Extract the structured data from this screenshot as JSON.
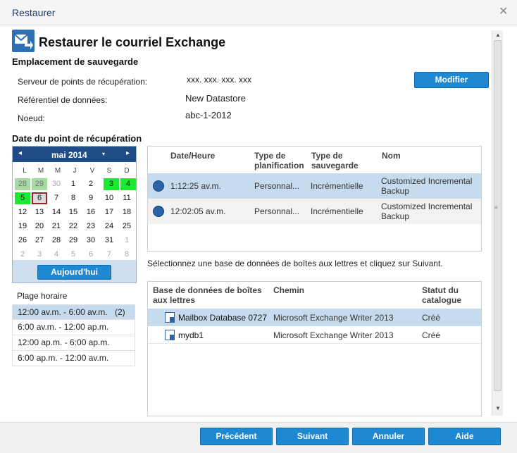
{
  "window": {
    "title": "Restaurer"
  },
  "header": {
    "title": "Restaurer le courriel Exchange"
  },
  "backup_location": {
    "heading": "Emplacement de sauvegarde",
    "server_label": "Serveur de points de récupération:",
    "server_value": "xxx. xxx. xxx. xxx",
    "datastore_label": "Référentiel de données:",
    "datastore_value": "New Datastore",
    "node_label": "Noeud:",
    "node_value": "abc-1-2012",
    "modify_button": "Modifier"
  },
  "recovery_point": {
    "heading": "Date du point de récupération",
    "calendar": {
      "month_label": "mai 2014",
      "prev_arrow": "◂",
      "next_arrow": "▸",
      "dropdown_arrow": "▾",
      "weekdays": [
        "L",
        "M",
        "M",
        "J",
        "V",
        "S",
        "D"
      ],
      "weeks": [
        [
          "28",
          "29",
          "30",
          "1",
          "2",
          "3",
          "4"
        ],
        [
          "5",
          "6",
          "7",
          "8",
          "9",
          "10",
          "11"
        ],
        [
          "12",
          "13",
          "14",
          "15",
          "16",
          "17",
          "18"
        ],
        [
          "19",
          "20",
          "21",
          "22",
          "23",
          "24",
          "25"
        ],
        [
          "26",
          "27",
          "28",
          "29",
          "30",
          "31",
          "1"
        ],
        [
          "2",
          "3",
          "4",
          "5",
          "6",
          "7",
          "8"
        ]
      ],
      "today_button": "Aujourd'hui",
      "colors": {
        "header": "#1f4c86",
        "has_backup": "#1ee832",
        "prev_month_backup": "#a7d9a3",
        "selected_border": "#8b2b2b"
      }
    },
    "time_range": {
      "heading": "Plage horaire",
      "items": [
        {
          "label": "12:00 av.m. - 6:00 av.m.",
          "count": "(2)"
        },
        {
          "label": "6:00 av.m. - 12:00 ap.m.",
          "count": ""
        },
        {
          "label": "12:00 ap.m. - 6:00 ap.m.",
          "count": ""
        },
        {
          "label": "6:00 ap.m. - 12:00 av.m.",
          "count": ""
        }
      ]
    },
    "points_table": {
      "columns": [
        "Date/Heure",
        "Type de planification",
        "Type de sauvegarde",
        "Nom"
      ],
      "rows": [
        {
          "time": "1:12:25 av.m.",
          "schedule": "Personnal...",
          "backup_type": "Incrémentielle",
          "name": "Customized Incremental Backup"
        },
        {
          "time": "12:02:05 av.m.",
          "schedule": "Personnal...",
          "backup_type": "Incrémentielle",
          "name": "Customized Incremental Backup"
        }
      ]
    }
  },
  "mailbox": {
    "instruction": "Sélectionnez une base de données de boîtes aux lettres et cliquez sur Suivant.",
    "columns": [
      "Base de données de boîtes aux lettres",
      "Chemin",
      "Statut du catalogue"
    ],
    "rows": [
      {
        "name": "Mailbox Database 0727",
        "path": "Microsoft Exchange Writer 2013",
        "status": "Créé"
      },
      {
        "name": "mydb1",
        "path": "Microsoft Exchange Writer 2013",
        "status": "Créé"
      }
    ]
  },
  "footer": {
    "previous": "Précédent",
    "next": "Suivant",
    "cancel": "Annuler",
    "help": "Aide"
  },
  "theme": {
    "accent": "#1e88d2",
    "selection": "#c6dcee",
    "title_color": "#1f3a6e"
  }
}
